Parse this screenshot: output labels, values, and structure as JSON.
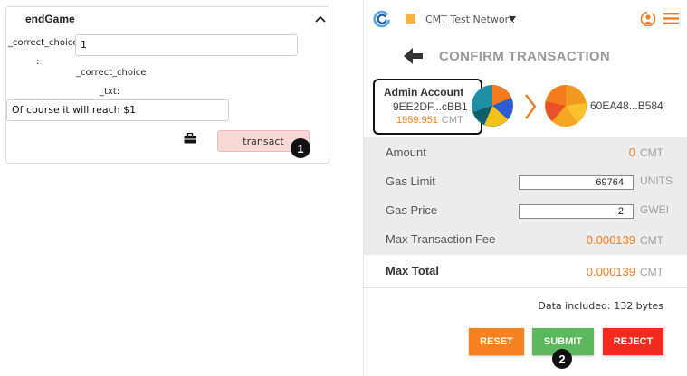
{
  "remix_panel": {
    "function_name": "endGame",
    "param1_label": "_correct_choice",
    "param1_colon": ":",
    "param1_value": "1",
    "param2_label": "_correct_choice",
    "param2_label_suffix": "_txt:",
    "param2_value": "Of course it will reach $1",
    "transact_label": "transact",
    "step_badge": "1"
  },
  "wallet": {
    "network_name": "CMT Test Network",
    "colors": {
      "accent": "#f57b1c",
      "network": "#f1b342",
      "reset": "#f5821f",
      "submit": "#5cb85c",
      "reject": "#f42a1d"
    },
    "title": "CONFIRM TRANSACTION",
    "from": {
      "name": "Admin Account",
      "address": "9EE2DF...cBB1",
      "balance": "1959.951",
      "balance_unit": "CMT"
    },
    "to": {
      "address": "60EA48...B584"
    },
    "details": {
      "amount_label": "Amount",
      "amount_value": "0",
      "amount_unit": "CMT",
      "gas_limit_label": "Gas Limit",
      "gas_limit_value": "69764",
      "gas_limit_unit": "UNITS",
      "gas_price_label": "Gas Price",
      "gas_price_value": "2",
      "gas_price_unit": "GWEI",
      "max_fee_label": "Max Transaction Fee",
      "max_fee_value": "0.000139",
      "max_fee_unit": "CMT"
    },
    "total": {
      "label": "Max Total",
      "value": "0.000139",
      "unit": "CMT"
    },
    "data_included": "Data included: 132 bytes",
    "buttons": {
      "reset": "RESET",
      "submit": "SUBMIT",
      "reject": "REJECT"
    },
    "step_badge": "2"
  }
}
